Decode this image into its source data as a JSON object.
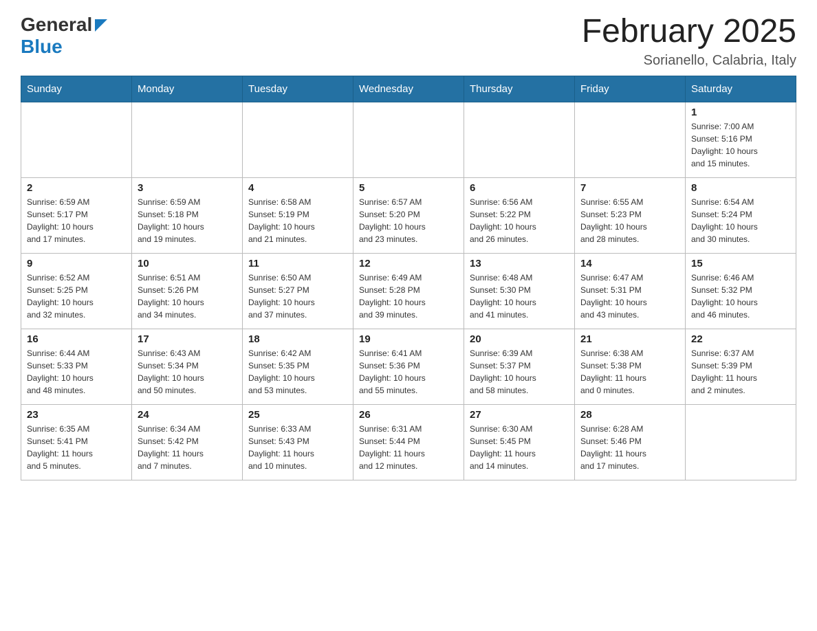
{
  "header": {
    "logo": {
      "general": "General",
      "blue": "Blue"
    },
    "month_title": "February 2025",
    "location": "Sorianello, Calabria, Italy"
  },
  "weekdays": [
    "Sunday",
    "Monday",
    "Tuesday",
    "Wednesday",
    "Thursday",
    "Friday",
    "Saturday"
  ],
  "weeks": [
    [
      {
        "day": "",
        "info": ""
      },
      {
        "day": "",
        "info": ""
      },
      {
        "day": "",
        "info": ""
      },
      {
        "day": "",
        "info": ""
      },
      {
        "day": "",
        "info": ""
      },
      {
        "day": "",
        "info": ""
      },
      {
        "day": "1",
        "info": "Sunrise: 7:00 AM\nSunset: 5:16 PM\nDaylight: 10 hours\nand 15 minutes."
      }
    ],
    [
      {
        "day": "2",
        "info": "Sunrise: 6:59 AM\nSunset: 5:17 PM\nDaylight: 10 hours\nand 17 minutes."
      },
      {
        "day": "3",
        "info": "Sunrise: 6:59 AM\nSunset: 5:18 PM\nDaylight: 10 hours\nand 19 minutes."
      },
      {
        "day": "4",
        "info": "Sunrise: 6:58 AM\nSunset: 5:19 PM\nDaylight: 10 hours\nand 21 minutes."
      },
      {
        "day": "5",
        "info": "Sunrise: 6:57 AM\nSunset: 5:20 PM\nDaylight: 10 hours\nand 23 minutes."
      },
      {
        "day": "6",
        "info": "Sunrise: 6:56 AM\nSunset: 5:22 PM\nDaylight: 10 hours\nand 26 minutes."
      },
      {
        "day": "7",
        "info": "Sunrise: 6:55 AM\nSunset: 5:23 PM\nDaylight: 10 hours\nand 28 minutes."
      },
      {
        "day": "8",
        "info": "Sunrise: 6:54 AM\nSunset: 5:24 PM\nDaylight: 10 hours\nand 30 minutes."
      }
    ],
    [
      {
        "day": "9",
        "info": "Sunrise: 6:52 AM\nSunset: 5:25 PM\nDaylight: 10 hours\nand 32 minutes."
      },
      {
        "day": "10",
        "info": "Sunrise: 6:51 AM\nSunset: 5:26 PM\nDaylight: 10 hours\nand 34 minutes."
      },
      {
        "day": "11",
        "info": "Sunrise: 6:50 AM\nSunset: 5:27 PM\nDaylight: 10 hours\nand 37 minutes."
      },
      {
        "day": "12",
        "info": "Sunrise: 6:49 AM\nSunset: 5:28 PM\nDaylight: 10 hours\nand 39 minutes."
      },
      {
        "day": "13",
        "info": "Sunrise: 6:48 AM\nSunset: 5:30 PM\nDaylight: 10 hours\nand 41 minutes."
      },
      {
        "day": "14",
        "info": "Sunrise: 6:47 AM\nSunset: 5:31 PM\nDaylight: 10 hours\nand 43 minutes."
      },
      {
        "day": "15",
        "info": "Sunrise: 6:46 AM\nSunset: 5:32 PM\nDaylight: 10 hours\nand 46 minutes."
      }
    ],
    [
      {
        "day": "16",
        "info": "Sunrise: 6:44 AM\nSunset: 5:33 PM\nDaylight: 10 hours\nand 48 minutes."
      },
      {
        "day": "17",
        "info": "Sunrise: 6:43 AM\nSunset: 5:34 PM\nDaylight: 10 hours\nand 50 minutes."
      },
      {
        "day": "18",
        "info": "Sunrise: 6:42 AM\nSunset: 5:35 PM\nDaylight: 10 hours\nand 53 minutes."
      },
      {
        "day": "19",
        "info": "Sunrise: 6:41 AM\nSunset: 5:36 PM\nDaylight: 10 hours\nand 55 minutes."
      },
      {
        "day": "20",
        "info": "Sunrise: 6:39 AM\nSunset: 5:37 PM\nDaylight: 10 hours\nand 58 minutes."
      },
      {
        "day": "21",
        "info": "Sunrise: 6:38 AM\nSunset: 5:38 PM\nDaylight: 11 hours\nand 0 minutes."
      },
      {
        "day": "22",
        "info": "Sunrise: 6:37 AM\nSunset: 5:39 PM\nDaylight: 11 hours\nand 2 minutes."
      }
    ],
    [
      {
        "day": "23",
        "info": "Sunrise: 6:35 AM\nSunset: 5:41 PM\nDaylight: 11 hours\nand 5 minutes."
      },
      {
        "day": "24",
        "info": "Sunrise: 6:34 AM\nSunset: 5:42 PM\nDaylight: 11 hours\nand 7 minutes."
      },
      {
        "day": "25",
        "info": "Sunrise: 6:33 AM\nSunset: 5:43 PM\nDaylight: 11 hours\nand 10 minutes."
      },
      {
        "day": "26",
        "info": "Sunrise: 6:31 AM\nSunset: 5:44 PM\nDaylight: 11 hours\nand 12 minutes."
      },
      {
        "day": "27",
        "info": "Sunrise: 6:30 AM\nSunset: 5:45 PM\nDaylight: 11 hours\nand 14 minutes."
      },
      {
        "day": "28",
        "info": "Sunrise: 6:28 AM\nSunset: 5:46 PM\nDaylight: 11 hours\nand 17 minutes."
      },
      {
        "day": "",
        "info": ""
      }
    ]
  ]
}
